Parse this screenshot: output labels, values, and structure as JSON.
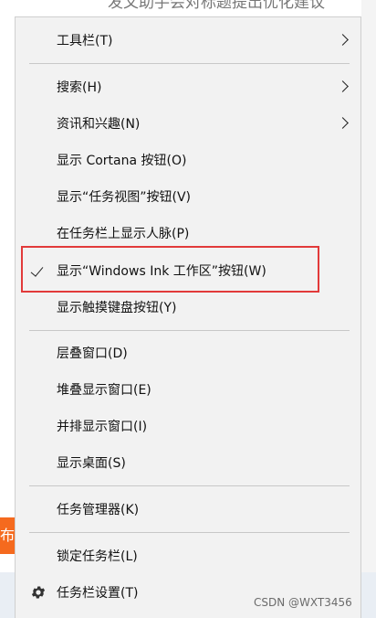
{
  "background": {
    "top_text": "发文助手会对标题提出优化建议",
    "left_tab_text": "布"
  },
  "menu": {
    "groups": [
      [
        {
          "label": "工具栏(T)",
          "submenu": true
        }
      ],
      [
        {
          "label": "搜索(H)",
          "submenu": true
        },
        {
          "label": "资讯和兴趣(N)",
          "submenu": true
        },
        {
          "label": "显示 Cortana 按钮(O)"
        },
        {
          "label": "显示“任务视图”按钮(V)"
        },
        {
          "label": "在任务栏上显示人脉(P)"
        },
        {
          "label": "显示“Windows Ink 工作区”按钮(W)",
          "checked": true,
          "highlighted": true
        },
        {
          "label": "显示触摸键盘按钮(Y)"
        }
      ],
      [
        {
          "label": "层叠窗口(D)"
        },
        {
          "label": "堆叠显示窗口(E)"
        },
        {
          "label": "并排显示窗口(I)"
        },
        {
          "label": "显示桌面(S)"
        }
      ],
      [
        {
          "label": "任务管理器(K)"
        }
      ],
      [
        {
          "label": "锁定任务栏(L)"
        },
        {
          "label": "任务栏设置(T)",
          "icon": "gear-icon"
        }
      ]
    ]
  },
  "watermark": "CSDN @WXT3456",
  "colors": {
    "menu_bg": "#f2f2f2",
    "highlight_border": "#e23a3a",
    "accent_orange": "#f56a1e"
  }
}
